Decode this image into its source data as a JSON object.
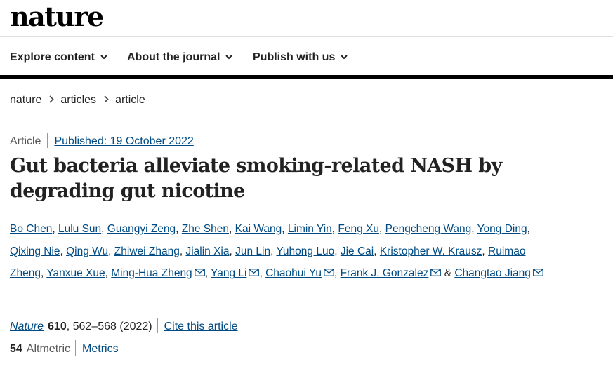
{
  "site": {
    "logo": "nature"
  },
  "nav": {
    "items": [
      {
        "label": "Explore content"
      },
      {
        "label": "About the journal"
      },
      {
        "label": "Publish with us"
      }
    ]
  },
  "breadcrumb": {
    "items": [
      "nature",
      "articles"
    ],
    "current": "article"
  },
  "article": {
    "type": "Article",
    "published": "Published: 19 October 2022",
    "title": "Gut bacteria alleviate smoking-related NASH by degrading gut nicotine",
    "authors": [
      {
        "name": "Bo Chen"
      },
      {
        "name": "Lulu Sun"
      },
      {
        "name": "Guangyi Zeng"
      },
      {
        "name": "Zhe Shen"
      },
      {
        "name": "Kai Wang"
      },
      {
        "name": "Limin Yin"
      },
      {
        "name": "Feng Xu"
      },
      {
        "name": "Pengcheng Wang"
      },
      {
        "name": "Yong Ding"
      },
      {
        "name": "Qixing Nie"
      },
      {
        "name": "Qing Wu"
      },
      {
        "name": "Zhiwei Zhang"
      },
      {
        "name": "Jialin Xia"
      },
      {
        "name": "Jun Lin"
      },
      {
        "name": "Yuhong Luo"
      },
      {
        "name": "Jie Cai"
      },
      {
        "name": "Kristopher W. Krausz"
      },
      {
        "name": "Ruimao Zheng"
      },
      {
        "name": "Yanxue Xue"
      },
      {
        "name": "Ming-Hua Zheng",
        "email": true
      },
      {
        "name": "Yang Li",
        "email": true
      },
      {
        "name": "Chaohui Yu",
        "email": true
      },
      {
        "name": "Frank J. Gonzalez",
        "email": true
      },
      {
        "name": "Changtao Jiang",
        "email": true
      }
    ],
    "author_line_breaks": {
      "line1_end_before": "Ding",
      "line1_partial": "Yong",
      "line2_partial": "Ding"
    },
    "ampersand": "&",
    "journal": "Nature",
    "volume": "610",
    "pages_year": ", 562–568 (2022)",
    "cite_link": "Cite this article",
    "altmetric_score": "54",
    "altmetric_label": "Altmetric",
    "metrics_link": "Metrics"
  },
  "colors": {
    "link": "#004b83",
    "text": "#222222",
    "rule": "#000000"
  },
  "icons": {
    "nav_chevron": "chevron-down-icon",
    "crumb_sep": "chevron-right-icon",
    "email": "envelope-icon"
  }
}
